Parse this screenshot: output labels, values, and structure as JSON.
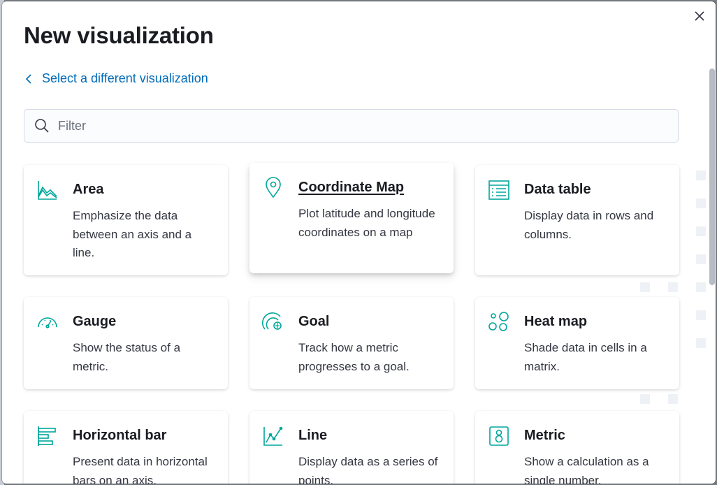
{
  "modal": {
    "title": "New visualization",
    "back_link": "Select a different visualization",
    "filter_placeholder": "Filter"
  },
  "accent_color": "#00a69b",
  "link_color": "#006bb8",
  "cards": [
    {
      "title": "Area",
      "description": "Emphasize the data between an axis and a line.",
      "icon": "area-chart-icon"
    },
    {
      "title": "Coordinate Map",
      "description": "Plot latitude and longitude coordinates on a map",
      "icon": "map-pin-icon"
    },
    {
      "title": "Data table",
      "description": "Display data in rows and columns.",
      "icon": "table-icon"
    },
    {
      "title": "Gauge",
      "description": "Show the status of a metric.",
      "icon": "gauge-icon"
    },
    {
      "title": "Goal",
      "description": "Track how a metric progresses to a goal.",
      "icon": "goal-icon"
    },
    {
      "title": "Heat map",
      "description": "Shade data in cells in a matrix.",
      "icon": "heatmap-icon"
    },
    {
      "title": "Horizontal bar",
      "description": "Present data in horizontal bars on an axis.",
      "icon": "horizontal-bar-icon"
    },
    {
      "title": "Line",
      "description": "Display data as a series of points.",
      "icon": "line-chart-icon"
    },
    {
      "title": "Metric",
      "description": "Show a calculation as a single number.",
      "icon": "metric-icon"
    }
  ]
}
